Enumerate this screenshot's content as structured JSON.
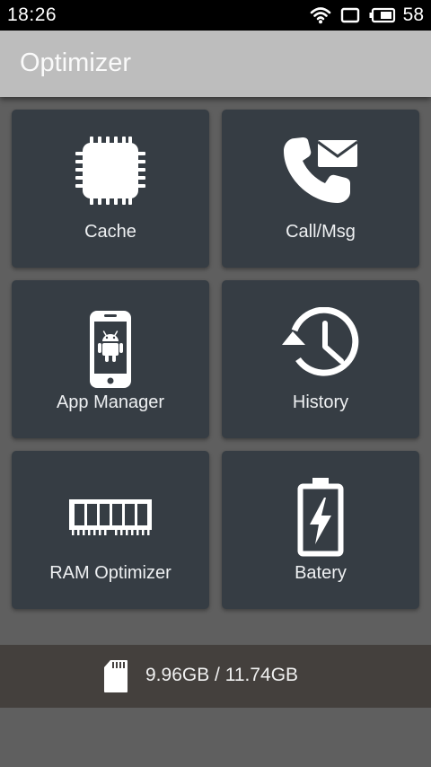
{
  "status_bar": {
    "time": "18:26",
    "battery_level": "58",
    "icons": [
      "wifi-icon",
      "recent-apps-icon",
      "battery-icon"
    ]
  },
  "app_bar": {
    "title": "Optimizer"
  },
  "tiles": [
    {
      "label": "Cache",
      "icon": "chip-icon"
    },
    {
      "label": "Call/Msg",
      "icon": "phone-message-icon"
    },
    {
      "label": "App Manager",
      "icon": "android-phone-icon"
    },
    {
      "label": "History",
      "icon": "history-clock-icon"
    },
    {
      "label": "RAM Optimizer",
      "icon": "ram-stick-icon"
    },
    {
      "label": "Batery",
      "icon": "battery-charging-icon"
    }
  ],
  "storage": {
    "icon": "sd-card-icon",
    "usage_text": "9.96GB / 11.74GB"
  },
  "colors": {
    "background": "#5f5f5f",
    "app_bar": "#bdbdbd",
    "tile": "#363d44",
    "storage_bar": "#44403d",
    "icon": "#ffffff"
  }
}
